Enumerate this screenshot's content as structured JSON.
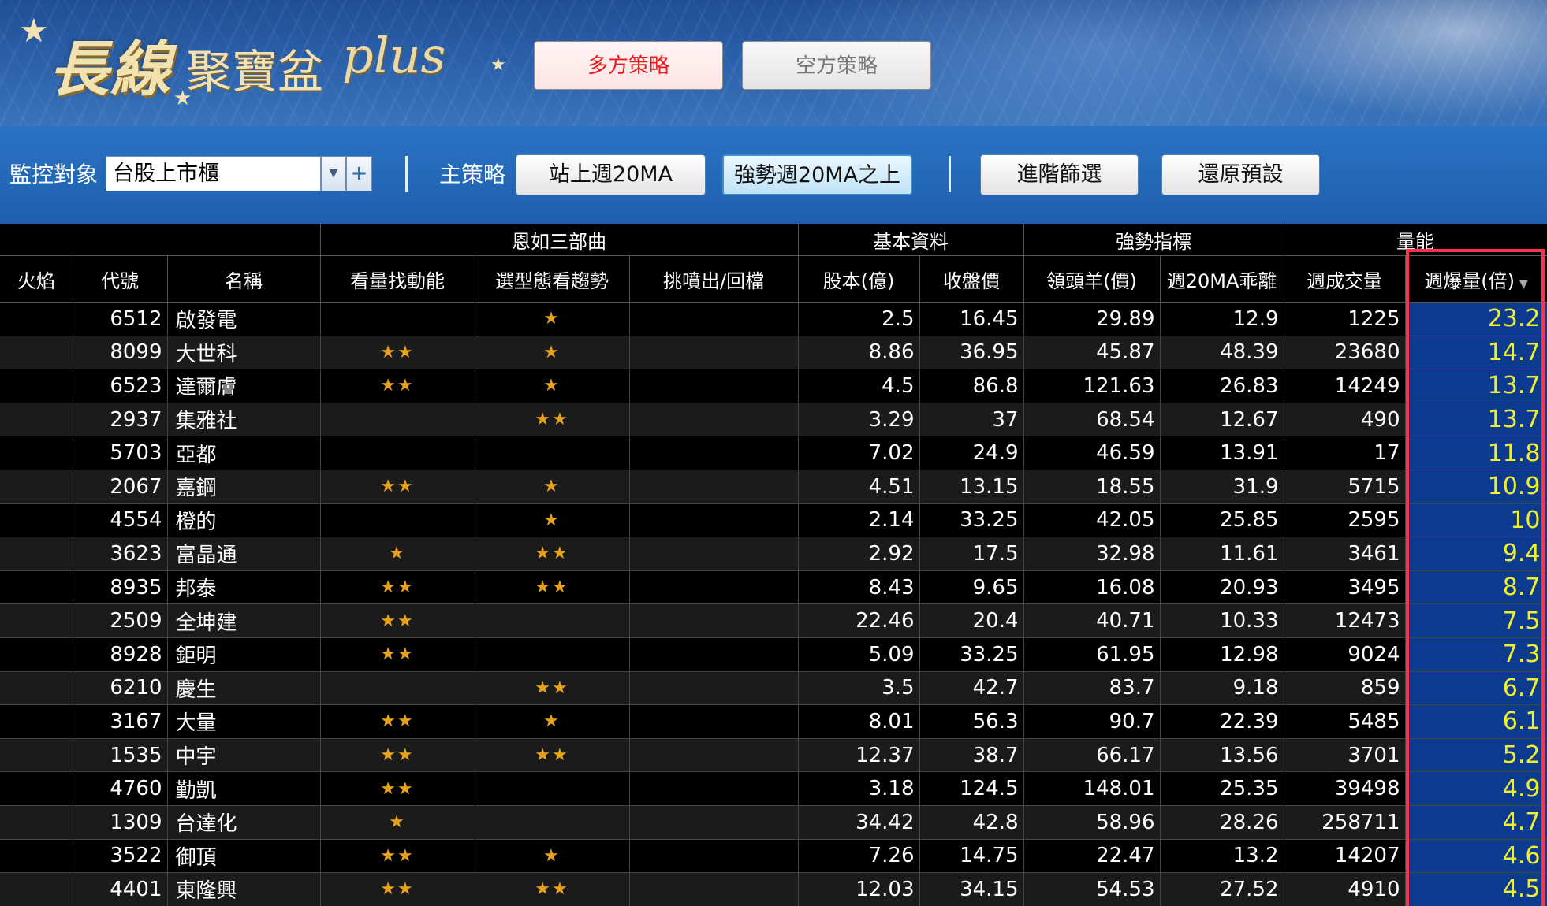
{
  "banner": {
    "logo_main": "長線",
    "logo_sub": "聚寶盆",
    "logo_plus": "plus",
    "long_strategy_label": "多方策略",
    "short_strategy_label": "空方策略"
  },
  "toolbar": {
    "monitor_label": "監控對象",
    "monitor_value": "台股上市櫃",
    "main_strategy_label": "主策略",
    "btn_above_20ma": "站上週20MA",
    "btn_strong_20ma": "強勢週20MA之上",
    "btn_advanced_filter": "進階篩選",
    "btn_reset_default": "還原預設"
  },
  "table": {
    "groups": {
      "three_part": "恩如三部曲",
      "basic_data": "基本資料",
      "strength": "強勢指標",
      "volume": "量能"
    },
    "headers": [
      "火焰",
      "代號",
      "名稱",
      "看量找動能",
      "選型態看趨勢",
      "挑噴出/回檔",
      "股本(億)",
      "收盤價",
      "領頭羊(價)",
      "週20MA乖離",
      "週成交量",
      "週爆量(倍)"
    ],
    "rows": [
      {
        "code": "6512",
        "name": "啟發電",
        "vol_star": "",
        "pattern_star": "★",
        "pick_star": "",
        "capital": "2.5",
        "close": "16.45",
        "leader": "29.89",
        "dev": "12.9",
        "weekly_vol": "1225",
        "burst": "23.2"
      },
      {
        "code": "8099",
        "name": "大世科",
        "vol_star": "★★",
        "pattern_star": "★",
        "pick_star": "",
        "capital": "8.86",
        "close": "36.95",
        "leader": "45.87",
        "dev": "48.39",
        "weekly_vol": "23680",
        "burst": "14.7"
      },
      {
        "code": "6523",
        "name": "達爾膚",
        "vol_star": "★★",
        "pattern_star": "★",
        "pick_star": "",
        "capital": "4.5",
        "close": "86.8",
        "leader": "121.63",
        "dev": "26.83",
        "weekly_vol": "14249",
        "burst": "13.7"
      },
      {
        "code": "2937",
        "name": "集雅社",
        "vol_star": "",
        "pattern_star": "★★",
        "pick_star": "",
        "capital": "3.29",
        "close": "37",
        "leader": "68.54",
        "dev": "12.67",
        "weekly_vol": "490",
        "burst": "13.7"
      },
      {
        "code": "5703",
        "name": "亞都",
        "vol_star": "",
        "pattern_star": "",
        "pick_star": "",
        "capital": "7.02",
        "close": "24.9",
        "leader": "46.59",
        "dev": "13.91",
        "weekly_vol": "17",
        "burst": "11.8"
      },
      {
        "code": "2067",
        "name": "嘉鋼",
        "vol_star": "★★",
        "pattern_star": "★",
        "pick_star": "",
        "capital": "4.51",
        "close": "13.15",
        "leader": "18.55",
        "dev": "31.9",
        "weekly_vol": "5715",
        "burst": "10.9"
      },
      {
        "code": "4554",
        "name": "橙的",
        "vol_star": "",
        "pattern_star": "★",
        "pick_star": "",
        "capital": "2.14",
        "close": "33.25",
        "leader": "42.05",
        "dev": "25.85",
        "weekly_vol": "2595",
        "burst": "10"
      },
      {
        "code": "3623",
        "name": "富晶通",
        "vol_star": "★",
        "pattern_star": "★★",
        "pick_star": "",
        "capital": "2.92",
        "close": "17.5",
        "leader": "32.98",
        "dev": "11.61",
        "weekly_vol": "3461",
        "burst": "9.4"
      },
      {
        "code": "8935",
        "name": "邦泰",
        "vol_star": "★★",
        "pattern_star": "★★",
        "pick_star": "",
        "capital": "8.43",
        "close": "9.65",
        "leader": "16.08",
        "dev": "20.93",
        "weekly_vol": "3495",
        "burst": "8.7"
      },
      {
        "code": "2509",
        "name": "全坤建",
        "vol_star": "★★",
        "pattern_star": "",
        "pick_star": "",
        "capital": "22.46",
        "close": "20.4",
        "leader": "40.71",
        "dev": "10.33",
        "weekly_vol": "12473",
        "burst": "7.5"
      },
      {
        "code": "8928",
        "name": "鉅明",
        "vol_star": "★★",
        "pattern_star": "",
        "pick_star": "",
        "capital": "5.09",
        "close": "33.25",
        "leader": "61.95",
        "dev": "12.98",
        "weekly_vol": "9024",
        "burst": "7.3"
      },
      {
        "code": "6210",
        "name": "慶生",
        "vol_star": "",
        "pattern_star": "★★",
        "pick_star": "",
        "capital": "3.5",
        "close": "42.7",
        "leader": "83.7",
        "dev": "9.18",
        "weekly_vol": "859",
        "burst": "6.7"
      },
      {
        "code": "3167",
        "name": "大量",
        "vol_star": "★★",
        "pattern_star": "★",
        "pick_star": "",
        "capital": "8.01",
        "close": "56.3",
        "leader": "90.7",
        "dev": "22.39",
        "weekly_vol": "5485",
        "burst": "6.1"
      },
      {
        "code": "1535",
        "name": "中宇",
        "vol_star": "★★",
        "pattern_star": "★★",
        "pick_star": "",
        "capital": "12.37",
        "close": "38.7",
        "leader": "66.17",
        "dev": "13.56",
        "weekly_vol": "3701",
        "burst": "5.2"
      },
      {
        "code": "4760",
        "name": "勤凱",
        "vol_star": "★★",
        "pattern_star": "",
        "pick_star": "",
        "capital": "3.18",
        "close": "124.5",
        "leader": "148.01",
        "dev": "25.35",
        "weekly_vol": "39498",
        "burst": "4.9"
      },
      {
        "code": "1309",
        "name": "台達化",
        "vol_star": "★",
        "pattern_star": "",
        "pick_star": "",
        "capital": "34.42",
        "close": "42.8",
        "leader": "58.96",
        "dev": "28.26",
        "weekly_vol": "258711",
        "burst": "4.7"
      },
      {
        "code": "3522",
        "name": "御頂",
        "vol_star": "★★",
        "pattern_star": "★",
        "pick_star": "",
        "capital": "7.26",
        "close": "14.75",
        "leader": "22.47",
        "dev": "13.2",
        "weekly_vol": "14207",
        "burst": "4.6"
      },
      {
        "code": "4401",
        "name": "東隆興",
        "vol_star": "★★",
        "pattern_star": "★★",
        "pick_star": "",
        "capital": "12.03",
        "close": "34.15",
        "leader": "54.53",
        "dev": "27.52",
        "weekly_vol": "4910",
        "burst": "4.5"
      }
    ]
  },
  "colors": {
    "star": "#e8a21a",
    "highlight_bg": "#0b3a8f",
    "highlight_text": "#f1ee2c",
    "highlight_border": "#ff2f4f"
  }
}
